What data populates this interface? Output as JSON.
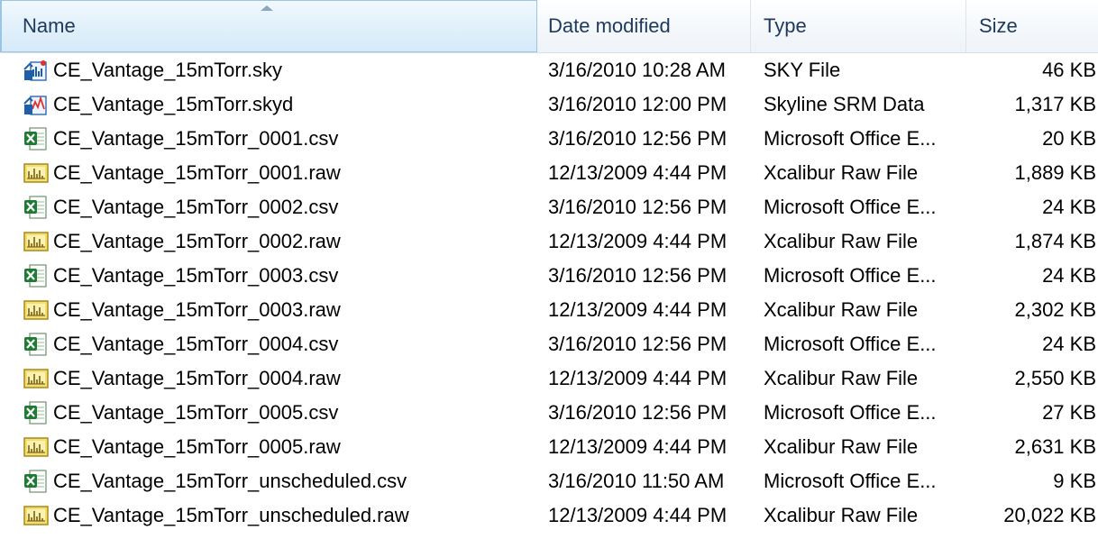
{
  "columns": {
    "name": "Name",
    "date": "Date modified",
    "type": "Type",
    "size": "Size"
  },
  "sort": {
    "column": "name",
    "direction": "ascending"
  },
  "files": [
    {
      "name": "CE_Vantage_15mTorr.sky",
      "date": "3/16/2010 10:28 AM",
      "type": "SKY File",
      "size": "46 KB",
      "icon": "skyline-document-icon"
    },
    {
      "name": "CE_Vantage_15mTorr.skyd",
      "date": "3/16/2010 12:00 PM",
      "type": "Skyline SRM Data",
      "size": "1,317 KB",
      "icon": "skyline-data-icon"
    },
    {
      "name": "CE_Vantage_15mTorr_0001.csv",
      "date": "3/16/2010 12:56 PM",
      "type": "Microsoft Office E...",
      "size": "20 KB",
      "icon": "excel-csv-icon"
    },
    {
      "name": "CE_Vantage_15mTorr_0001.raw",
      "date": "12/13/2009 4:44 PM",
      "type": "Xcalibur Raw File",
      "size": "1,889 KB",
      "icon": "xcalibur-raw-icon"
    },
    {
      "name": "CE_Vantage_15mTorr_0002.csv",
      "date": "3/16/2010 12:56 PM",
      "type": "Microsoft Office E...",
      "size": "24 KB",
      "icon": "excel-csv-icon"
    },
    {
      "name": "CE_Vantage_15mTorr_0002.raw",
      "date": "12/13/2009 4:44 PM",
      "type": "Xcalibur Raw File",
      "size": "1,874 KB",
      "icon": "xcalibur-raw-icon"
    },
    {
      "name": "CE_Vantage_15mTorr_0003.csv",
      "date": "3/16/2010 12:56 PM",
      "type": "Microsoft Office E...",
      "size": "24 KB",
      "icon": "excel-csv-icon"
    },
    {
      "name": "CE_Vantage_15mTorr_0003.raw",
      "date": "12/13/2009 4:44 PM",
      "type": "Xcalibur Raw File",
      "size": "2,302 KB",
      "icon": "xcalibur-raw-icon"
    },
    {
      "name": "CE_Vantage_15mTorr_0004.csv",
      "date": "3/16/2010 12:56 PM",
      "type": "Microsoft Office E...",
      "size": "24 KB",
      "icon": "excel-csv-icon"
    },
    {
      "name": "CE_Vantage_15mTorr_0004.raw",
      "date": "12/13/2009 4:44 PM",
      "type": "Xcalibur Raw File",
      "size": "2,550 KB",
      "icon": "xcalibur-raw-icon"
    },
    {
      "name": "CE_Vantage_15mTorr_0005.csv",
      "date": "3/16/2010 12:56 PM",
      "type": "Microsoft Office E...",
      "size": "27 KB",
      "icon": "excel-csv-icon"
    },
    {
      "name": "CE_Vantage_15mTorr_0005.raw",
      "date": "12/13/2009 4:44 PM",
      "type": "Xcalibur Raw File",
      "size": "2,631 KB",
      "icon": "xcalibur-raw-icon"
    },
    {
      "name": "CE_Vantage_15mTorr_unscheduled.csv",
      "date": "3/16/2010 11:50 AM",
      "type": "Microsoft Office E...",
      "size": "9 KB",
      "icon": "excel-csv-icon"
    },
    {
      "name": "CE_Vantage_15mTorr_unscheduled.raw",
      "date": "12/13/2009 4:44 PM",
      "type": "Xcalibur Raw File",
      "size": "20,022 KB",
      "icon": "xcalibur-raw-icon"
    }
  ],
  "colors": {
    "header_text": "#1e395b",
    "sorted_header_bg": "#d6eaf8",
    "excel_green": "#1e7b34",
    "raw_yellow": "#d9b62a",
    "skyline_blue": "#1f5fa8"
  }
}
